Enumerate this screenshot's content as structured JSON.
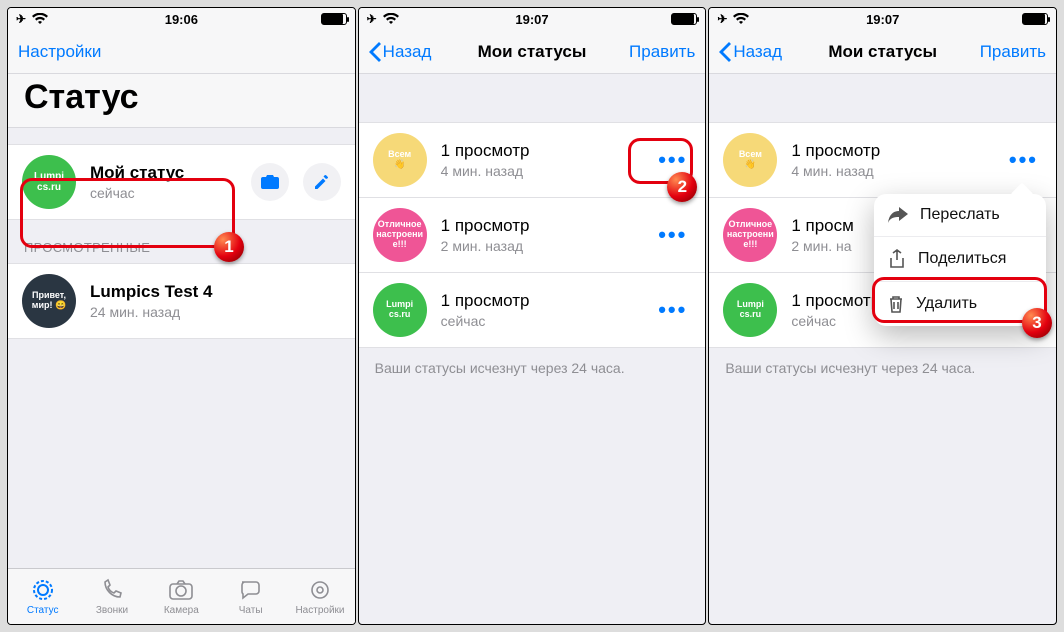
{
  "time1": "19:06",
  "time2": "19:07",
  "screen1": {
    "nav": {
      "settings": "Настройки"
    },
    "title": "Статус",
    "myStatus": {
      "title": "Мой статус",
      "sub": "сейчас",
      "avatar": "Lumpi\ncs.ru"
    },
    "viewedHeader": "ПРОСМОТРЕННЫЕ",
    "viewed": {
      "title": "Lumpics Test 4",
      "sub": "24 мин. назад",
      "avatar": "Привет,\nмир! 😄"
    },
    "tabs": [
      "Статус",
      "Звонки",
      "Камера",
      "Чаты",
      "Настройки"
    ]
  },
  "screen2": {
    "nav": {
      "back": "Назад",
      "title": "Мои статусы",
      "edit": "Править"
    },
    "rows": [
      {
        "avatar": "Всем\n👋",
        "cls": "ava-yellow",
        "title": "1 просмотр",
        "sub": "4 мин. назад"
      },
      {
        "avatar": "Отличное\nнастроени\nе!!!",
        "cls": "ava-pink",
        "title": "1 просмотр",
        "sub": "2 мин. назад"
      },
      {
        "avatar": "Lumpi\ncs.ru",
        "cls": "ava-green",
        "title": "1 просмотр",
        "sub": "сейчас"
      }
    ],
    "footer": "Ваши статусы исчезнут через 24 часа."
  },
  "screen3": {
    "nav": {
      "back": "Назад",
      "title": "Мои статусы",
      "edit": "Править"
    },
    "rows": [
      {
        "avatar": "Всем\n👋",
        "cls": "ava-yellow",
        "title": "1 просмотр",
        "sub": "4 мин. назад"
      },
      {
        "avatar": "Отличное\nнастроени\nе!!!",
        "cls": "ava-pink",
        "title": "1 просм",
        "sub": "2 мин. на"
      },
      {
        "avatar": "Lumpi\ncs.ru",
        "cls": "ava-green",
        "title": "1 просмотр",
        "sub": "сейчас"
      }
    ],
    "footer": "Ваши статусы исчезнут через 24 часа.",
    "menu": [
      "Переслать",
      "Поделиться",
      "Удалить"
    ]
  }
}
